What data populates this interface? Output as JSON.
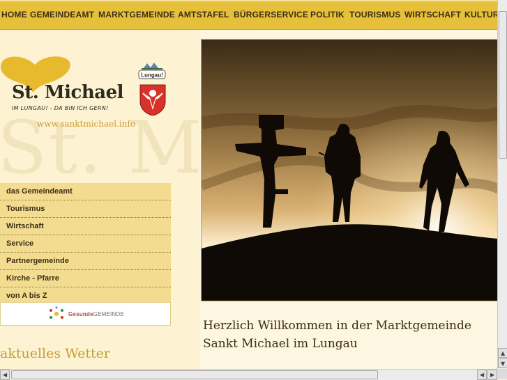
{
  "nav": {
    "items": [
      "HOME",
      "GEMEINDEAMT",
      "MARKTGEMEINDE",
      "AMTSTAFEL",
      "BÜRGERSERVICE",
      "POLITIK",
      "TOURISMUS",
      "WIRTSCHAFT",
      "KULTUR"
    ]
  },
  "brand": {
    "name": "St. Michael",
    "tagline": "IM LUNGAU! - DA BIN ICH GERN!",
    "url": "www.sanktmichael.info",
    "watermark": "St. M",
    "lungau_badge": "Lungau!"
  },
  "sidebar": {
    "items": [
      "das Gemeindeamt",
      "Tourismus",
      "Wirtschaft",
      "Service",
      "Partnergemeinde",
      "Kirche - Pfarre",
      "von A bis Z"
    ],
    "banner": {
      "part1": "Gesunde",
      "part2": "GEMEINDE"
    }
  },
  "weather": {
    "heading": "aktuelles Wetter"
  },
  "main": {
    "welcome_line1": "Herzlich Willkommen in der Marktgemeinde",
    "welcome_line2": "Sankt Michael im Lungau"
  },
  "colors": {
    "nav_bg": "#e6c03a",
    "page_bg": "#fdf6e0",
    "menu_bg": "#f3dc8f",
    "accent_gold": "#c89b3a"
  }
}
